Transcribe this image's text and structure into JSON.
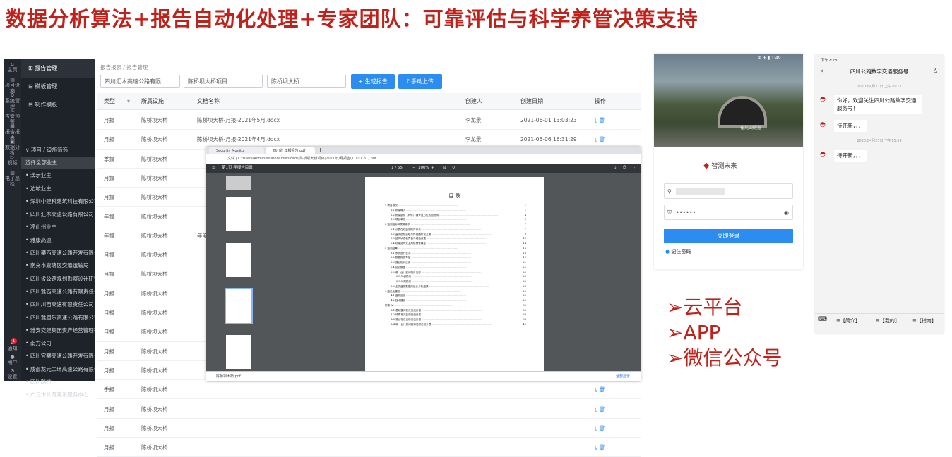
{
  "headline": "数据分析算法+报告自动化处理+专家团队：可靠评估与科学养管决策支持",
  "sidebar": {
    "rail": [
      {
        "icon": "home-icon",
        "label": "主页"
      },
      {
        "icon": "project-icon",
        "label": "项目设施"
      },
      {
        "icon": "system-icon",
        "label": "系统管理"
      },
      {
        "icon": "alarm-icon",
        "label": "告警预警"
      },
      {
        "icon": "report-icon",
        "label": "报告报表"
      },
      {
        "icon": "data-icon",
        "label": "数据分析"
      },
      {
        "icon": "video-icon",
        "label": "视频"
      },
      {
        "icon": "eboard-icon",
        "label": "电子巡检"
      },
      {
        "icon": "notify-icon",
        "label": "通知"
      },
      {
        "icon": "user-icon",
        "label": "用户"
      },
      {
        "icon": "settings-icon",
        "label": "设置"
      }
    ],
    "menu": [
      "报告管理",
      "模板管理",
      "制作模板"
    ],
    "project_title": "项目 / 设施筛选",
    "badge": "1",
    "projects": [
      "选择全部业主",
      "演示业主",
      "边坡业主",
      "深圳中建科建筑科技有限公司",
      "四川汇木高速公路有限公司",
      "凉山州业主",
      "雅康高速",
      "四川攀西高速公路开发有限公司",
      "南充市嘉陵区交通运输局",
      "四川省公路规划勘察设计研究院",
      "四川雅西高速公路有限责任公司",
      "四川川西高速有限责任公司",
      "四川雅眉乐高速公路有限公司",
      "雅安交建集团资产经营管理有限",
      "南方公司",
      "四川宜攀高速公路开发有限公司",
      "成都龙元二环高速公路有限公司",
      "四川路桥",
      "广元市公路建设服务中心"
    ]
  },
  "main": {
    "breadcrumb": "报告报表 / 报告管理",
    "filters": [
      "四川汇木高速公路有限...",
      "陈桥坝大桥项目",
      "陈桥坝大桥"
    ],
    "btn_generate": "+ 生成报告",
    "btn_upload": "⤒ 手动上传",
    "headers": [
      "类型",
      "所属设施",
      "文档名称",
      "创建人",
      "创建日期",
      "操作"
    ],
    "rows": [
      [
        "月报",
        "陈桥坝大桥",
        "陈桥坝大桥-月报-2021年5月.docx",
        "李龙景",
        "2021-06-01 13:03:23"
      ],
      [
        "月报",
        "陈桥坝大桥",
        "陈桥坝大桥-月报-2021年4月.docx",
        "李龙景",
        "2021-05-06 16:31:29"
      ],
      [
        "季报",
        "陈桥坝大桥",
        "",
        "",
        " "
      ],
      [
        "月报",
        "陈桥坝大桥",
        "",
        "",
        ""
      ],
      [
        "月报",
        "陈桥坝大桥",
        "",
        "",
        ""
      ],
      [
        "年报",
        "陈桥坝大桥",
        "",
        "",
        ""
      ],
      [
        "年报",
        "陈桥坝大桥",
        "年度",
        "",
        ""
      ],
      [
        "月报",
        "陈桥坝大桥",
        "",
        "",
        ""
      ],
      [
        "月报",
        "陈桥坝大桥",
        "",
        "",
        ""
      ],
      [
        "月报",
        "陈桥坝大桥",
        "",
        "",
        ""
      ],
      [
        "月报",
        "陈桥坝大桥",
        "",
        "",
        ""
      ],
      [
        "月报",
        "陈桥坝大桥",
        "",
        "",
        ""
      ],
      [
        "月报",
        "陈桥坝大桥",
        "",
        "",
        ""
      ],
      [
        "月报",
        "陈桥坝大桥",
        "",
        "",
        ""
      ],
      [
        "季报",
        "陈桥坝大桥",
        "",
        "",
        ""
      ],
      [
        "月报",
        "陈桥坝大桥",
        "",
        "",
        ""
      ],
      [
        "月报",
        "陈桥坝大桥",
        "",
        "",
        ""
      ],
      [
        "月报",
        "陈桥坝大桥",
        "",
        "",
        ""
      ]
    ]
  },
  "pdf": {
    "tab1": "Security Monitor",
    "tab2": "四川省 年报报告.pdf",
    "address": "文件 | C:/Users/Administrator/Downloads/陈桥坝大桥项目(2021年)月报告(1.1~1.31).pdf",
    "toolbar_title": "第1页 年报告目录",
    "page_info": "1 / 55",
    "zoom": "100%",
    "download_file": "陈桥坝大桥.pdf",
    "download_all": "全部显示",
    "toc_title": "目 录",
    "toc": [
      [
        "1 项目概况",
        "1"
      ],
      [
        "1.1 桥梁概况",
        "1"
      ],
      [
        "1.2 桥梁部件（构件）编号及方位布图说明",
        "4"
      ],
      [
        "1.3 项目单位",
        "5"
      ],
      [
        "2 监测指标和预警体系",
        "7"
      ],
      [
        "2.1 仪表在线监测硬件体系",
        "7"
      ],
      [
        "2.2 监测指标选取与传感器布设方案",
        "9"
      ],
      [
        "2.3 结构状态临界值与阈值设置",
        "13"
      ],
      [
        "2.4 桥梁结构安全风险预警模型",
        "14"
      ],
      [
        "3 监测结果",
        "18"
      ],
      [
        "3.1 系统运行状况",
        "18"
      ],
      [
        "3.2 数据报告导航",
        "19"
      ],
      [
        "3.3 强台相对应用",
        "21"
      ],
      [
        "3.4 统计数据",
        "22"
      ],
      [
        "3.5 墩（台）梁间相对位移",
        "23"
      ],
      [
        "3.5.1 横桥向",
        "23"
      ],
      [
        "3.5.2 顺桥向",
        "25"
      ],
      [
        "3.6 全桥监测数据月统计分析结果",
        "26"
      ],
      [
        "4 结论及建议",
        "29"
      ],
      [
        "4.1 监测结论",
        "29"
      ],
      [
        "4.2 技术建议",
        "29"
      ],
      [
        "附录 A",
        "30"
      ],
      [
        "A.1 基础整体变位日统计表",
        "30"
      ],
      [
        "A.2 倾角相对监测日统计表",
        "33"
      ],
      [
        "A.3 强台相位位移日统计表",
        "38"
      ],
      [
        "A.4 墩（台）梁间相对位移日统计表",
        "40"
      ]
    ]
  },
  "app": {
    "brand": "智测未来",
    "status": "⊕ ✈ ▮ 1:49",
    "password_mask": "••••••",
    "login": "立即登录",
    "remember": "记住密码",
    "tunnel_text": "雀儿山隧道"
  },
  "features": [
    "➢云平台",
    "➢APP",
    "➢微信公众号"
  ],
  "wechat": {
    "status": "下午2:23",
    "title": "四川公路数字交通服务号",
    "time1": "2020年4月27日 上午10:12",
    "msg1": "你好，欢迎关注四川公路数字交通服务号！",
    "msg2": "待开新，，，",
    "time2": "2020年4月27日 下午15:59",
    "msg3": "待开新，，，",
    "menu": [
      "≡【简介】",
      "≡【我的】",
      "≡【指南】"
    ]
  },
  "colors": {
    "accent": "#2d8cf0",
    "headline": "#c0211a",
    "sidebar": "#1e2329"
  }
}
